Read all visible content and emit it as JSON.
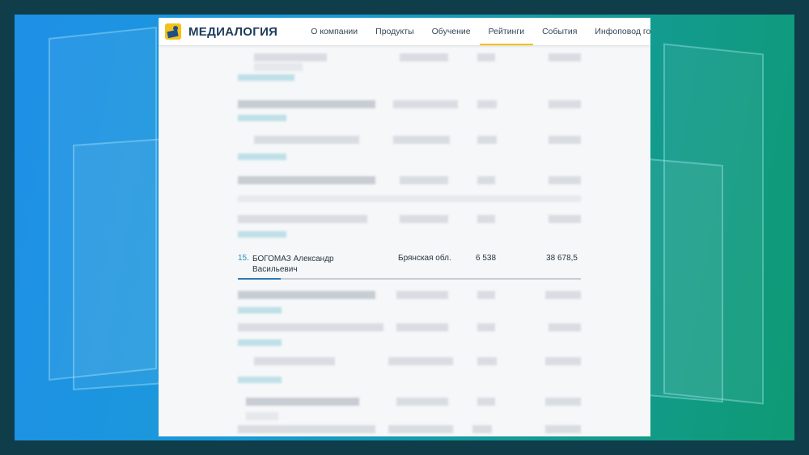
{
  "brand": {
    "name": "МЕДИАЛОГИЯ",
    "logo_icon": "medialogia-logo-icon",
    "accent_color": "#f1c21b",
    "primary_color": "#1f3c5a"
  },
  "nav": {
    "items": [
      {
        "label": "О компании",
        "active": false
      },
      {
        "label": "Продукты",
        "active": false
      },
      {
        "label": "Обучение",
        "active": false
      },
      {
        "label": "Рейтинги",
        "active": true
      },
      {
        "label": "События",
        "active": false
      },
      {
        "label": "Инфоповод года",
        "active": false
      }
    ]
  },
  "highlighted_row": {
    "rank": "15.",
    "name": "БОГОМАЗ Александр Васильевич",
    "region": "Брянская обл.",
    "value1": "6 538",
    "value2": "38 678,5",
    "progress": 0.125,
    "progress_color": "#2b79b8"
  }
}
